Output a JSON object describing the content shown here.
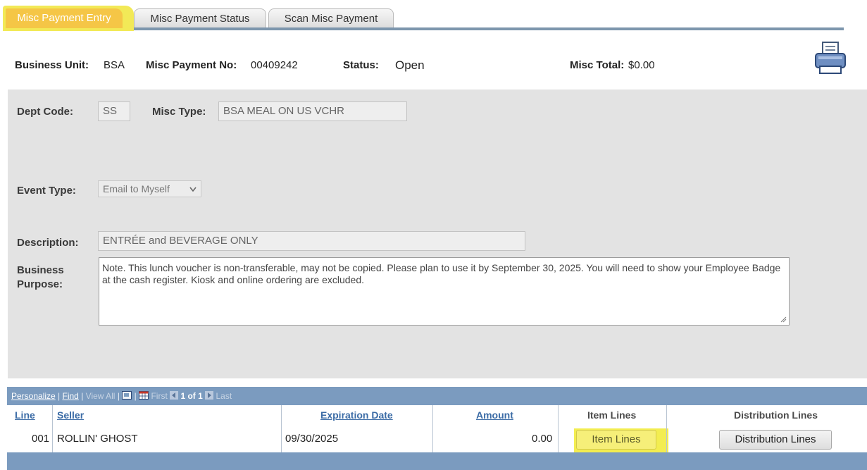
{
  "tabs": {
    "entry": "Misc Payment Entry",
    "status": "Misc Payment Status",
    "scan": "Scan Misc Payment"
  },
  "header": {
    "business_unit_label": "Business Unit:",
    "business_unit_value": "BSA",
    "misc_payment_no_label": "Misc Payment No:",
    "misc_payment_no_value": "00409242",
    "status_label": "Status:",
    "status_value": "Open",
    "misc_total_label": "Misc Total:",
    "misc_total_value": "$0.00"
  },
  "form": {
    "dept_code_label": "Dept Code:",
    "dept_code_value": "SS",
    "misc_type_label": "Misc Type:",
    "misc_type_value": "BSA MEAL ON US VCHR",
    "event_type_label": "Event Type:",
    "event_type_value": "Email to Myself",
    "description_label": "Description:",
    "description_value": "ENTRÉE and BEVERAGE ONLY",
    "business_label_1": "Business",
    "business_label_2": "Purpose:",
    "business_purpose_value": "Note.  This lunch voucher is non-transferable, may not be copied.  Please plan to use it by September 30, 2025. You will need to show your Employee Badge at the cash register.  Kiosk and online ordering are excluded."
  },
  "grid": {
    "nav": {
      "personalize": "Personalize",
      "find": "Find",
      "view_all": "View All",
      "first": "First",
      "range": "1 of 1",
      "last": "Last"
    },
    "columns": {
      "line": "Line",
      "seller": "Seller",
      "expiration_date": "Expiration Date",
      "amount": "Amount",
      "item_lines": "Item Lines",
      "distribution_lines": "Distribution Lines"
    },
    "rows": [
      {
        "line": "001",
        "seller": "ROLLIN' GHOST",
        "expiration_date": "09/30/2025",
        "amount": "0.00",
        "item_lines_button": "Item Lines",
        "distribution_lines_button": "Distribution Lines"
      }
    ]
  },
  "icons": {
    "printer": "printer-icon",
    "first": "arrow-left-icon",
    "last": "arrow-right-icon",
    "zoom": "zoom-icon",
    "grid": "spreadsheet-icon",
    "dropdown": "chevron-down-icon",
    "resize": "resize-handle-icon"
  },
  "colors": {
    "highlight": "#f3ed50",
    "grid_bar": "#7b9bbf",
    "panel": "#e3e3e3",
    "link": "#3c6ca6"
  }
}
